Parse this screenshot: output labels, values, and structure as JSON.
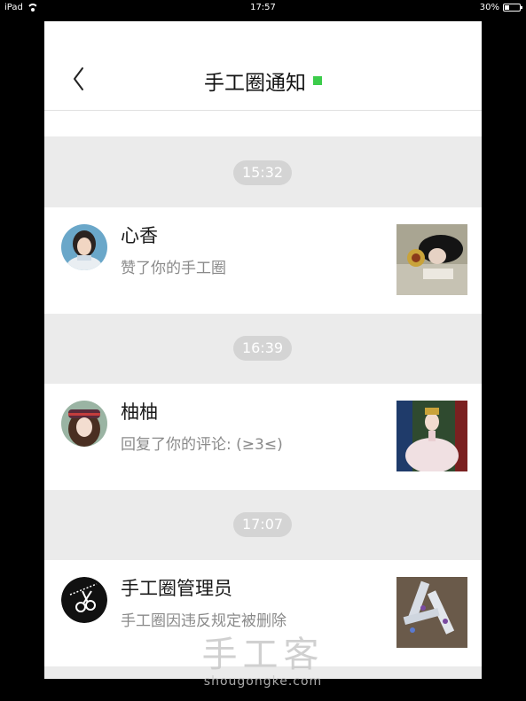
{
  "status_bar": {
    "device": "iPad",
    "time": "17:57",
    "battery": "30%"
  },
  "nav": {
    "title": "手工圈通知",
    "accent_color": "#3ccc4b"
  },
  "notifications": [
    {
      "time": "15:32",
      "name": "心香",
      "message": "赞了你的手工圈",
      "avatar_icon": "user-avatar-icon",
      "thumbnail": "doll-photo"
    },
    {
      "time": "16:39",
      "name": "柚柚",
      "message": "回复了你的评论: (≥3≤)",
      "avatar_icon": "user-avatar-icon",
      "thumbnail": "doll-photo"
    },
    {
      "time": "17:07",
      "name": "手工圈管理员",
      "message": "手工圈因违反规定被删除",
      "avatar_icon": "scissors-icon",
      "thumbnail": "craft-photo"
    }
  ],
  "watermark": {
    "brand": "手工客",
    "domain": "shougongke.com"
  }
}
